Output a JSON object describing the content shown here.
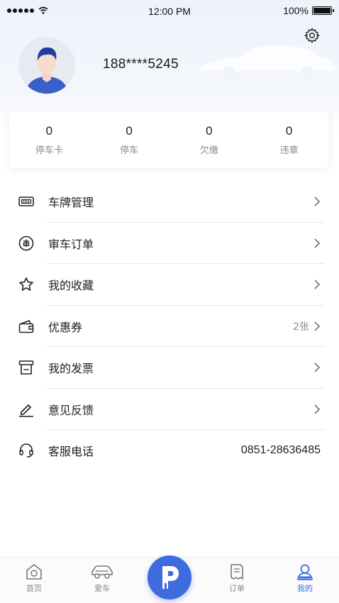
{
  "status_bar": {
    "time": "12:00 PM",
    "battery": "100%"
  },
  "profile": {
    "phone": "188****5245"
  },
  "stats": [
    {
      "value": "0",
      "label": "停车卡"
    },
    {
      "value": "0",
      "label": "停车"
    },
    {
      "value": "0",
      "label": "欠缴"
    },
    {
      "value": "0",
      "label": "违章"
    }
  ],
  "menu": [
    {
      "label": "车牌管理",
      "icon": "license-plate-icon"
    },
    {
      "label": "审车订单",
      "icon": "inspection-icon"
    },
    {
      "label": "我的收藏",
      "icon": "star-icon"
    },
    {
      "label": "优惠券",
      "icon": "wallet-icon",
      "extra": "2张"
    },
    {
      "label": "我的发票",
      "icon": "invoice-icon"
    },
    {
      "label": "意见反馈",
      "icon": "pencil-icon"
    },
    {
      "label": "客服电话",
      "icon": "headset-icon",
      "phone": "0851-28636485"
    }
  ],
  "tabs": [
    {
      "label": "首页",
      "icon": "home-icon"
    },
    {
      "label": "爱车",
      "icon": "car-icon"
    },
    {
      "label": "订单",
      "icon": "receipt-icon"
    },
    {
      "label": "我的",
      "icon": "person-icon",
      "active": true
    }
  ],
  "colors": {
    "accent": "#3f6be0",
    "avatar_shirt": "#3a5fc8"
  }
}
